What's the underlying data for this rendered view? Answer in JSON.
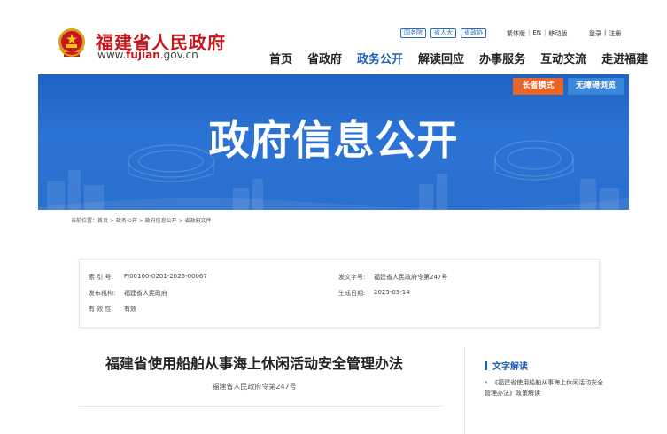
{
  "header": {
    "site_title": "福建省人民政府",
    "site_url_prefix": "www.",
    "site_url_brand": "fujian",
    "site_url_suffix": ".gov.cn",
    "top_chips": [
      "国务院",
      "省人大",
      "省政协"
    ],
    "util_links": [
      "繁体版",
      "EN",
      "移动版"
    ],
    "login_links": [
      "登录",
      "注册"
    ],
    "nav": [
      {
        "label": "首页",
        "active": false
      },
      {
        "label": "省政府",
        "active": false
      },
      {
        "label": "政务公开",
        "active": true
      },
      {
        "label": "解读回应",
        "active": false
      },
      {
        "label": "办事服务",
        "active": false
      },
      {
        "label": "互动交流",
        "active": false
      },
      {
        "label": "走进福建",
        "active": false
      }
    ]
  },
  "banner": {
    "title": "政府信息公开",
    "elder_mode_label": "长者模式",
    "accessible_label": "无障碍浏览"
  },
  "breadcrumb": "当前位置：首页 > 政务公开 > 政府信息公开 > 省政府文件",
  "meta": {
    "index_label": "索 引 号:",
    "index_value": "FJ00100-0201-2025-00067",
    "doc_no_label": "发文字号:",
    "doc_no_value": "福建省人民政府令第247号",
    "issuer_label": "发布机构:",
    "issuer_value": "福建省人民政府",
    "date_label": "生成日期:",
    "date_value": "2025-03-14",
    "validity_label": "有 效 性:",
    "validity_value": "有效"
  },
  "document": {
    "title": "福建省使用船舶从事海上休闲活动安全管理办法",
    "subtitle": "福建省人民政府令第247号"
  },
  "sidebar": {
    "heading": "文字解读",
    "link_text": "《福建省使用船舶从事海上休闲活动安全管理办法》政策解读"
  },
  "colors": {
    "brand_red": "#c8161d",
    "nav_active_blue": "#1f5fb4",
    "banner_blue": "#2a6fcf",
    "elder_orange": "#e8652a",
    "access_blue": "#3a86d8"
  }
}
